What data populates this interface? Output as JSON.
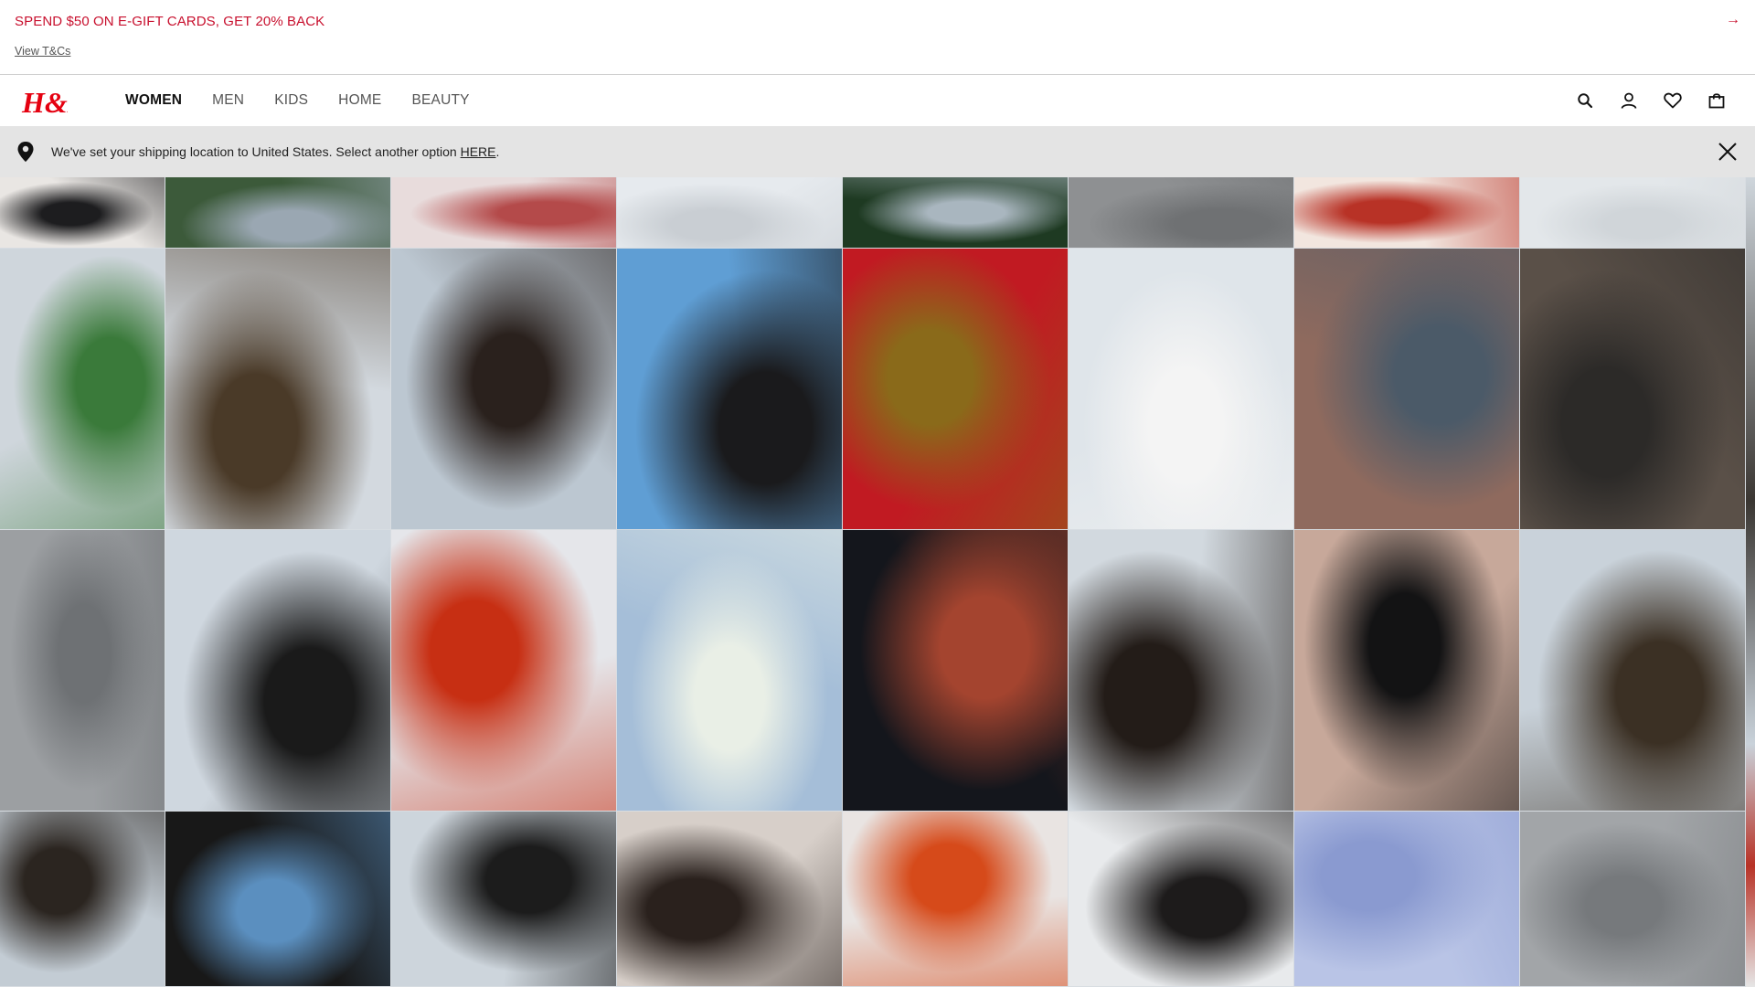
{
  "promo": {
    "title": "SPEND $50 ON E-GIFT CARDS, GET 20% BACK",
    "link": "View T&Cs",
    "arrow": "→",
    "color": "#c8102e"
  },
  "header": {
    "logo": "H&M",
    "logo_color": "#e50010",
    "nav": [
      {
        "label": "WOMEN",
        "active": true
      },
      {
        "label": "MEN",
        "active": false
      },
      {
        "label": "KIDS",
        "active": false
      },
      {
        "label": "HOME",
        "active": false
      },
      {
        "label": "BEAUTY",
        "active": false
      }
    ],
    "icons": [
      "search-icon",
      "account-icon",
      "favorites-icon",
      "shopping-bag-icon"
    ]
  },
  "notice": {
    "text_before": "We've set your shipping location to United States. Select another option ",
    "link": "HERE",
    "text_after": ".",
    "icons": [
      "location-pin-icon",
      "close-icon"
    ]
  },
  "mosaic": {
    "tiles": [
      {
        "name": "tile-lace-hem",
        "c1": "#e9e6e3",
        "c2": "#1d1d1f"
      },
      {
        "name": "tile-green-leaves",
        "c1": "#3c5a3a",
        "c2": "#9aa7b2"
      },
      {
        "name": "tile-pink-blur",
        "c1": "#e8dcdc",
        "c2": "#b44a4a"
      },
      {
        "name": "tile-white-dress-top",
        "c1": "#e6eaee",
        "c2": "#c9ced3"
      },
      {
        "name": "tile-dark-leaves",
        "c1": "#1e3a22",
        "c2": "#a9b6bf"
      },
      {
        "name": "tile-concrete-top",
        "c1": "#8e9092",
        "c2": "#6f7173"
      },
      {
        "name": "tile-red-petal-top",
        "c1": "#f2e6df",
        "c2": "#b83226"
      },
      {
        "name": "tile-white-dress-top-2",
        "c1": "#e3e7ea",
        "c2": "#d0d5d9"
      },
      {
        "name": "tile-flower-bouquet",
        "c1": "#cfd6dc",
        "c2": "#3a7a3a"
      },
      {
        "name": "tile-leather-jacket-portrait",
        "c1": "#d3d9df",
        "c2": "#4a3a28"
      },
      {
        "name": "tile-face-closeup",
        "c1": "#bcc7d1",
        "c2": "#2a211d"
      },
      {
        "name": "tile-sky-portrait",
        "c1": "#5f9ed4",
        "c2": "#1a1a1c"
      },
      {
        "name": "tile-red-orchid",
        "c1": "#c11a22",
        "c2": "#8a6a1a"
      },
      {
        "name": "tile-white-eyelet-dress",
        "c1": "#dfe5ea",
        "c2": "#f4f4f4"
      },
      {
        "name": "tile-eye-closeup",
        "c1": "#8f6a5e",
        "c2": "#4b5a68"
      },
      {
        "name": "tile-blurred-window",
        "c1": "#5a5048",
        "c2": "#2c2a28"
      },
      {
        "name": "tile-concrete-crack",
        "c1": "#9c9fa2",
        "c2": "#6e7174"
      },
      {
        "name": "tile-lace-top-skirt",
        "c1": "#cfd7df",
        "c2": "#1a1a1a"
      },
      {
        "name": "tile-red-skirt",
        "c1": "#e5e6ea",
        "c2": "#c72f13"
      },
      {
        "name": "tile-white-blossoms",
        "c1": "#a5bed8",
        "c2": "#e9efe6"
      },
      {
        "name": "tile-red-bokeh",
        "c1": "#14161c",
        "c2": "#a4442f"
      },
      {
        "name": "tile-windswept-hair",
        "c1": "#d2d9df",
        "c2": "#231c18"
      },
      {
        "name": "tile-black-skirt",
        "c1": "#c7a89a",
        "c2": "#131314"
      },
      {
        "name": "tile-jacket-portrait-2",
        "c1": "#c9d2da",
        "c2": "#3b3024"
      },
      {
        "name": "tile-jacket-full",
        "c1": "#c3ccd4",
        "c2": "#2b2520"
      },
      {
        "name": "tile-denim-belt",
        "c1": "#181818",
        "c2": "#5b8fbf"
      },
      {
        "name": "tile-lace-top-2",
        "c1": "#cdd5dc",
        "c2": "#1c1c1c"
      },
      {
        "name": "tile-downcast-face",
        "c1": "#d7cfc9",
        "c2": "#2a211d"
      },
      {
        "name": "tile-orange-petal",
        "c1": "#e9e4e2",
        "c2": "#d64a1a"
      },
      {
        "name": "tile-resting-pose",
        "c1": "#e8eaec",
        "c2": "#1d1b1b"
      },
      {
        "name": "tile-blue-flowers",
        "c1": "#b9c4e6",
        "c2": "#8a9ad0"
      },
      {
        "name": "tile-concrete-2",
        "c1": "#a2a5a8",
        "c2": "#76797c"
      }
    ]
  }
}
